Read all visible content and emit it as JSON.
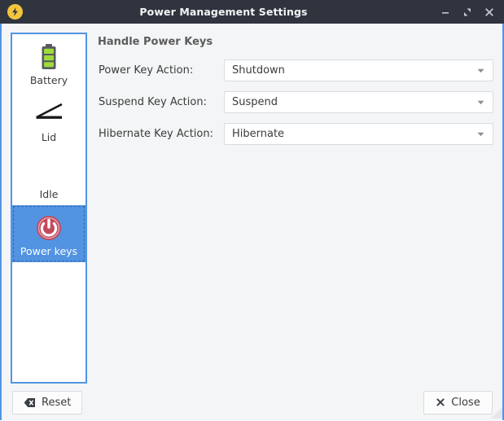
{
  "window": {
    "title": "Power Management Settings",
    "app_icon": "lightning-bolt-icon",
    "controls": {
      "minimize": "minimize-icon",
      "maximize": "maximize-icon",
      "close": "close-icon"
    },
    "colors": {
      "titlebar_bg": "#2f343f",
      "window_border": "#5294e2",
      "body_bg": "#f4f5f6",
      "selection_bg": "#5294e2",
      "battery_green": "#8ae234",
      "power_icon_red": "#cc4a5e",
      "app_icon_yellow": "#f2c53d"
    }
  },
  "sidebar": {
    "items": [
      {
        "label": "Battery",
        "icon": "battery-icon",
        "selected": false
      },
      {
        "label": "Lid",
        "icon": "laptop-lid-icon",
        "selected": false
      },
      {
        "label": "Idle",
        "icon": "missing-icon",
        "selected": false
      },
      {
        "label": "Power keys",
        "icon": "power-button-icon",
        "selected": true
      }
    ]
  },
  "content": {
    "section_title": "Handle Power Keys",
    "rows": [
      {
        "label": "Power Key Action:",
        "value": "Shutdown"
      },
      {
        "label": "Suspend Key Action:",
        "value": "Suspend"
      },
      {
        "label": "Hibernate Key Action:",
        "value": "Hibernate"
      }
    ]
  },
  "footer": {
    "reset_label": "Reset",
    "reset_icon": "backspace-icon",
    "close_label": "Close",
    "close_icon": "x-icon"
  }
}
